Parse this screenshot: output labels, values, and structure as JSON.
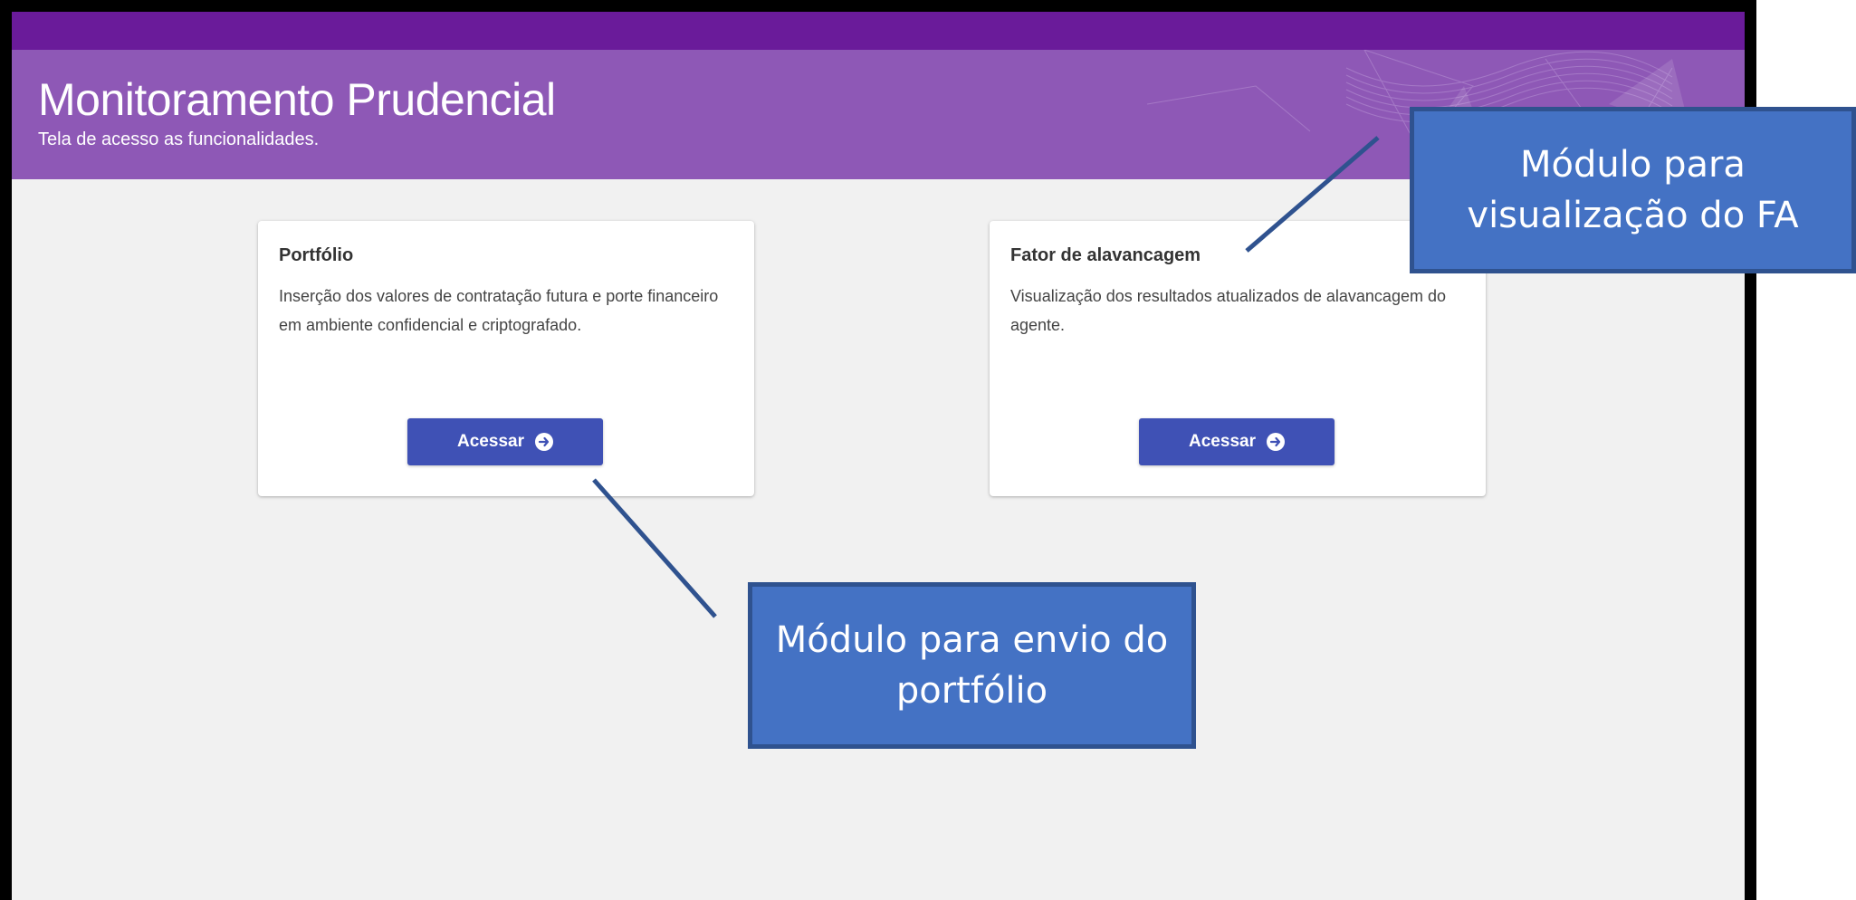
{
  "header": {
    "title": "Monitoramento Prudencial",
    "subtitle": "Tela de acesso as funcionalidades."
  },
  "cards": [
    {
      "title": "Portfólio",
      "description": "Inserção dos valores de contratação futura e porte financeiro em ambiente confidencial e criptografado.",
      "button_label": "Acessar"
    },
    {
      "title": "Fator de alavancagem",
      "description": "Visualização dos resultados atualizados de alavancagem do agente.",
      "button_label": "Acessar"
    }
  ],
  "annotations": {
    "fa_module": "Módulo para visualização do FA",
    "portfolio_module": "Módulo para envio do portfólio"
  },
  "colors": {
    "topbar": "#6a1b9a",
    "banner": "#8e58b6",
    "button": "#3f51b5",
    "callout": "#4472c4"
  },
  "icons": {
    "button_icon": "arrow-circle-right-icon"
  }
}
